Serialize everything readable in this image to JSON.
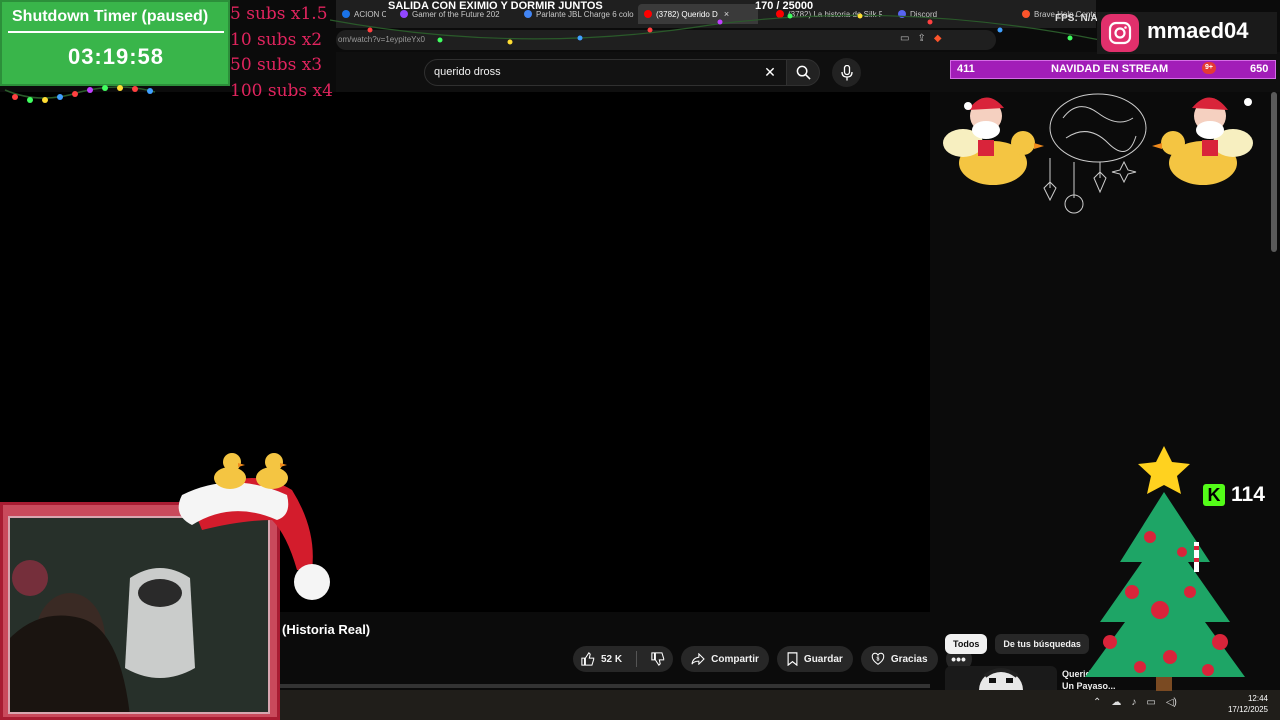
{
  "browser": {
    "tabs": [
      {
        "label": "ACION CH",
        "color": "#1a73e8"
      },
      {
        "label": "Gamer of the Future 202",
        "color": "#9146ff"
      },
      {
        "label": "Parlante JBL Charge 6 colo",
        "color": "#4285f4"
      },
      {
        "label": "(3782) Querido D",
        "color": "#ff0000"
      },
      {
        "label": "(3782) La historia de Silk R",
        "color": "#ff0000"
      },
      {
        "label": "Discord",
        "color": "#5865f2"
      },
      {
        "label": "Brave Help Cente",
        "color": "#fb542b"
      }
    ],
    "active_tab_index": 3,
    "address_text": "om/watch?v=1eypiteYx0",
    "fps_label": "FPS: N/A"
  },
  "stream_header": {
    "title": "SALIDA CON EXIMIO Y DORMIR JUNTOS",
    "counter": "170  /  25000"
  },
  "youtube": {
    "search_value": "querido dross",
    "video_title": "(Historia Real)",
    "actions": {
      "likes": "52 K",
      "share": "Compartir",
      "save": "Guardar",
      "thanks": "Gracias"
    },
    "chips": [
      "Todos",
      "De tus búsquedas"
    ],
    "rec_title": "Querido Dross: Un Payaso..."
  },
  "timer": {
    "title": "Shutdown Timer (paused)",
    "value": "03:19:58"
  },
  "subs_multipliers": [
    "5 subs x1.5",
    "10 subs x2",
    "50 subs x3",
    "100 subs x4"
  ],
  "instagram": {
    "handle": "mmaed04"
  },
  "navbar": {
    "left": "411",
    "center": "NAVIDAD EN STREAM",
    "right": "650",
    "badge": "9+"
  },
  "kick": {
    "count": "114"
  },
  "taskbar": {
    "time": "12:44",
    "date": "17/12/2025"
  },
  "colors": {
    "timer_bg": "#39b54a",
    "subs_text": "#e0245e",
    "navbar_bg": "#a21db8",
    "kick_green": "#53fc18",
    "cam_border": "#a81c32"
  }
}
